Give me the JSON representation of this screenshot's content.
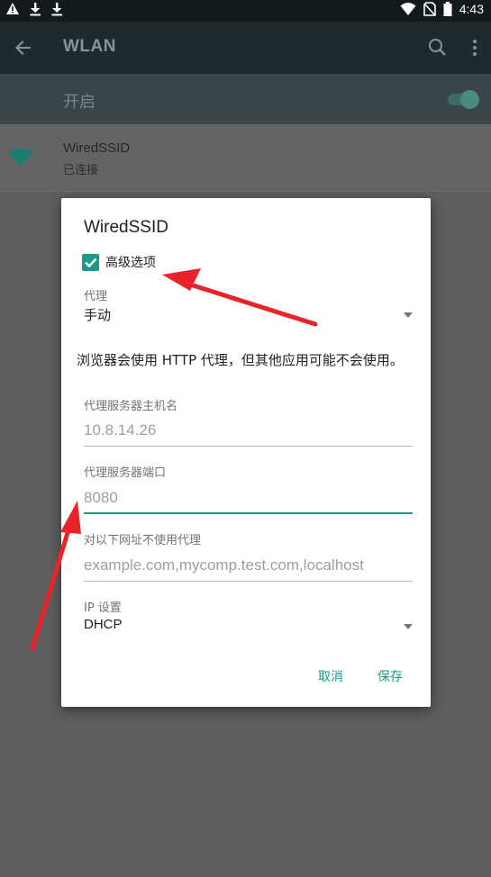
{
  "status_bar": {
    "time": "4:43",
    "left_icons": [
      "warning-icon",
      "download-icon",
      "download-icon"
    ],
    "right_icons": [
      "wifi-icon",
      "no-sim-icon",
      "battery-icon"
    ]
  },
  "app_bar": {
    "title": "WLAN",
    "back_icon": "arrow-left-icon",
    "search_icon": "search-icon",
    "more_icon": "more-vert-icon"
  },
  "switch_bar": {
    "label": "开启",
    "enabled": true
  },
  "network": {
    "ssid": "WiredSSID",
    "status": "已连接"
  },
  "dialog": {
    "title": "WiredSSID",
    "advanced_options": {
      "label": "高级选项",
      "checked": true
    },
    "proxy": {
      "label": "代理",
      "value": "手动"
    },
    "proxy_note": "浏览器会使用 HTTP 代理，但其他应用可能不会使用。",
    "proxy_hostname": {
      "label": "代理服务器主机名",
      "placeholder": "10.8.14.26"
    },
    "proxy_port": {
      "label": "代理服务器端口",
      "placeholder": "8080"
    },
    "bypass": {
      "label": "对以下网址不使用代理",
      "placeholder": "example.com,mycomp.test.com,localhost"
    },
    "ip_settings": {
      "label": "IP 设置",
      "value": "DHCP"
    },
    "cancel_label": "取消",
    "save_label": "保存"
  },
  "colors": {
    "accent": "#1b9a8c",
    "annotation_arrow": "#e8242a"
  }
}
